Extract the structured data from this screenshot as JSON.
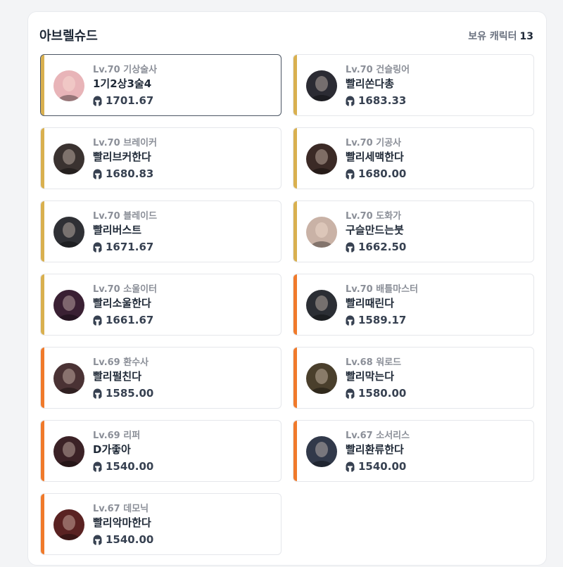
{
  "panel": {
    "title": "아브렐슈드",
    "owned_label": "보유 캐릭터",
    "owned_count": "13"
  },
  "characters": [
    {
      "level": "Lv.70 기상술사",
      "name": "1기2상3술4",
      "item_level": "1701.67",
      "bar": "gold",
      "avatar": "#e8b4b8",
      "selected": true
    },
    {
      "level": "Lv.70 건슬링어",
      "name": "빨리쏜다총",
      "item_level": "1683.33",
      "bar": "gold",
      "avatar": "#2b2b33"
    },
    {
      "level": "Lv.70 브레이커",
      "name": "빨리브커한다",
      "item_level": "1680.83",
      "bar": "gold",
      "avatar": "#3a3230"
    },
    {
      "level": "Lv.70 기공사",
      "name": "빨리세맥한다",
      "item_level": "1680.00",
      "bar": "gold",
      "avatar": "#3b2a26"
    },
    {
      "level": "Lv.70 블레이드",
      "name": "빨리버스트",
      "item_level": "1671.67",
      "bar": "gold",
      "avatar": "#2f3035"
    },
    {
      "level": "Lv.70 도화가",
      "name": "구슬만드는붓",
      "item_level": "1662.50",
      "bar": "gold",
      "avatar": "#c9b2a6"
    },
    {
      "level": "Lv.70 소울이터",
      "name": "빨리소울한다",
      "item_level": "1661.67",
      "bar": "gold",
      "avatar": "#3a2033"
    },
    {
      "level": "Lv.70 배틀마스터",
      "name": "빨리때린다",
      "item_level": "1589.17",
      "bar": "orange",
      "avatar": "#2b2e34"
    },
    {
      "level": "Lv.69 환수사",
      "name": "빨리펄친다",
      "item_level": "1585.00",
      "bar": "orange",
      "avatar": "#4a3234"
    },
    {
      "level": "Lv.68 워로드",
      "name": "빨리막는다",
      "item_level": "1580.00",
      "bar": "orange",
      "avatar": "#4a3f2c"
    },
    {
      "level": "Lv.69 리퍼",
      "name": "D가좋아",
      "item_level": "1540.00",
      "bar": "orange",
      "avatar": "#3b2226"
    },
    {
      "level": "Lv.67 소서리스",
      "name": "빨리환류한다",
      "item_level": "1540.00",
      "bar": "orange",
      "avatar": "#31394a"
    },
    {
      "level": "Lv.67 데모닉",
      "name": "빨리악마한다",
      "item_level": "1540.00",
      "bar": "orange",
      "avatar": "#5a2222"
    }
  ],
  "colors": {
    "gold_bar": "#d9b04f",
    "orange_bar": "#f07a2b"
  },
  "icons": {
    "item_level": "helmet-icon"
  }
}
